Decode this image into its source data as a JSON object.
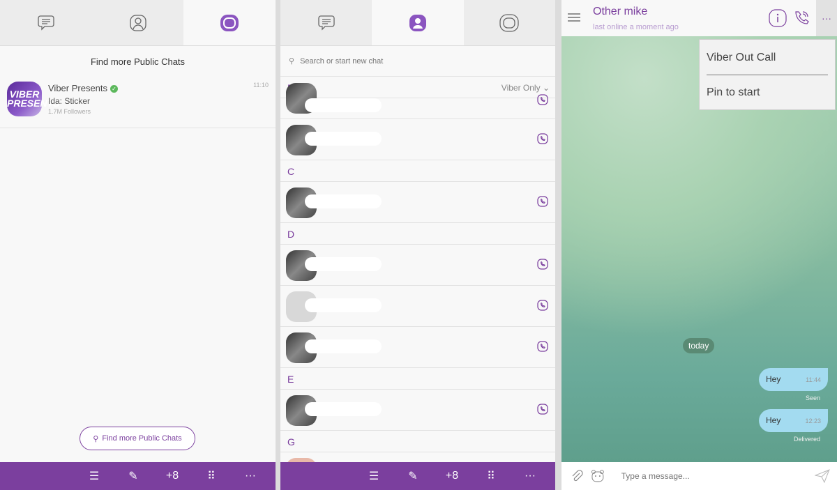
{
  "colors": {
    "accent": "#7b3f9e",
    "bubble": "#a3dbf0",
    "online_check": "#5cb85c"
  },
  "panel1": {
    "tabs": [
      {
        "icon": "chat-icon"
      },
      {
        "icon": "contacts-icon"
      },
      {
        "icon": "public-chats-icon",
        "active": true
      }
    ],
    "find_title": "Find more Public Chats",
    "public_chat": {
      "name": "Viber Presents",
      "subtitle": "Ida: Sticker",
      "followers": "1.7M Followers",
      "time": "11:10",
      "avatar_text": "VIBER PRESENTS"
    },
    "find_button": "Find more Public Chats"
  },
  "panel2": {
    "search_placeholder": "Search or start new chat",
    "filter": "Viber Only",
    "sections": [
      "B",
      "C",
      "D",
      "E",
      "G"
    ]
  },
  "bottom_bar": [
    "list-icon",
    "compose-icon",
    "add-contact-icon",
    "dialpad-icon",
    "more-icon"
  ],
  "chat": {
    "contact": "Other mike",
    "status": "last online a moment ago",
    "menu": [
      "Viber Out Call",
      "Pin to start"
    ],
    "date_label": "today",
    "messages": [
      {
        "text": "Hey",
        "time": "11:44",
        "status": "Seen"
      },
      {
        "text": "Hey",
        "time": "12:23",
        "status": "Delivered"
      }
    ],
    "input_placeholder": "Type a message..."
  }
}
